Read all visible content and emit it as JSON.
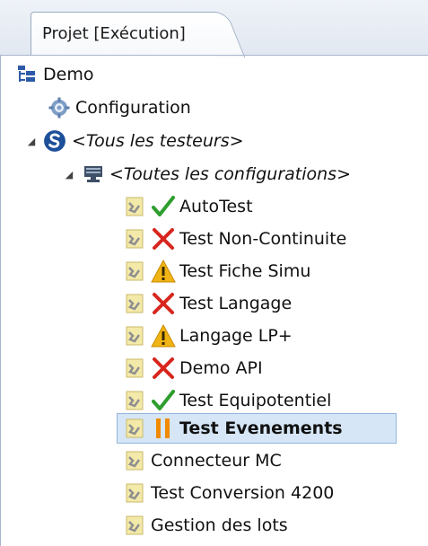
{
  "tab": {
    "label": "Projet [Exécution]"
  },
  "tree": {
    "root": {
      "label": "Demo"
    },
    "config": {
      "label": "Configuration"
    },
    "testers": {
      "label": "<Tous les testeurs>"
    },
    "configs": {
      "label": "<Toutes les configurations>"
    },
    "items": [
      {
        "label": "AutoTest",
        "status": "pass"
      },
      {
        "label": "Test Non-Continuite",
        "status": "fail"
      },
      {
        "label": "Test Fiche Simu",
        "status": "warning"
      },
      {
        "label": "Test Langage",
        "status": "fail"
      },
      {
        "label": "Langage LP+",
        "status": "warning"
      },
      {
        "label": "Demo API",
        "status": "fail"
      },
      {
        "label": "Test Equipotentiel",
        "status": "pass"
      },
      {
        "label": "Test Evenements",
        "status": "paused",
        "selected": true
      },
      {
        "label": "Connecteur MC",
        "status": "none"
      },
      {
        "label": "Test Conversion 4200",
        "status": "none"
      },
      {
        "label": "Gestion des lots",
        "status": "none"
      }
    ]
  },
  "colors": {
    "pass": "#2e9e2e",
    "fail": "#d7261e",
    "warning": "#f0b414",
    "paused": "#f08a00",
    "selection": "#d6e6f6"
  }
}
